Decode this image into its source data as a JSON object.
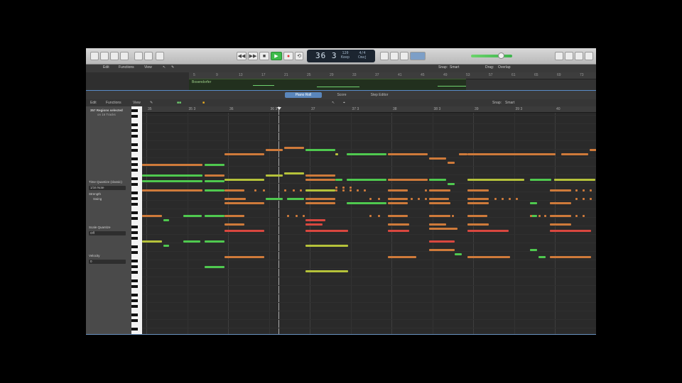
{
  "transport": {
    "position_main": "36 3",
    "tempo_value": "120",
    "tempo_label": "Keep",
    "signature_value": "4/4",
    "signature_key": "Cmaj"
  },
  "tracks_menu": {
    "edit": "Edit",
    "functions": "Functions",
    "view": "View",
    "snap_label": "Snap:",
    "snap_value": "Smart",
    "drag_label": "Drag:",
    "drag_value": "Overlap"
  },
  "tracks_ruler": [
    "5",
    "9",
    "13",
    "17",
    "21",
    "25",
    "29",
    "33",
    "37",
    "41",
    "45",
    "49",
    "53",
    "57",
    "61",
    "65",
    "69",
    "73"
  ],
  "region": {
    "name": "Bosendorfer"
  },
  "editor_tabs": [
    "Piano Roll",
    "Score",
    "Step Editor"
  ],
  "piano_roll_bar": {
    "edit": "Edit",
    "functions": "Functions",
    "view": "View",
    "snap_label": "Snap:",
    "snap_value": "Smart"
  },
  "piano_roll_ruler": [
    "35",
    "35 3",
    "36",
    "36 3",
    "37",
    "37 3",
    "38",
    "38 3",
    "39",
    "39 3",
    "40",
    "40 3"
  ],
  "inspector": {
    "selection": "357 Regions selected",
    "sub": "on 16 Tracks",
    "time_quantize": "Time Quantize (classic)",
    "quantize_value": "1/16 Note",
    "strength_label": "Strength",
    "swing_label": "Swing",
    "scale_quantize": "Scale Quantize",
    "scale_value": "Off",
    "velocity_label": "Velocity",
    "velocity_value": "0"
  },
  "colors": {
    "green": "#4fc94f",
    "yellow_green": "#b5c23a",
    "orange": "#cf7a3a",
    "red": "#d9473f",
    "accent_blue": "#5a86bb"
  }
}
